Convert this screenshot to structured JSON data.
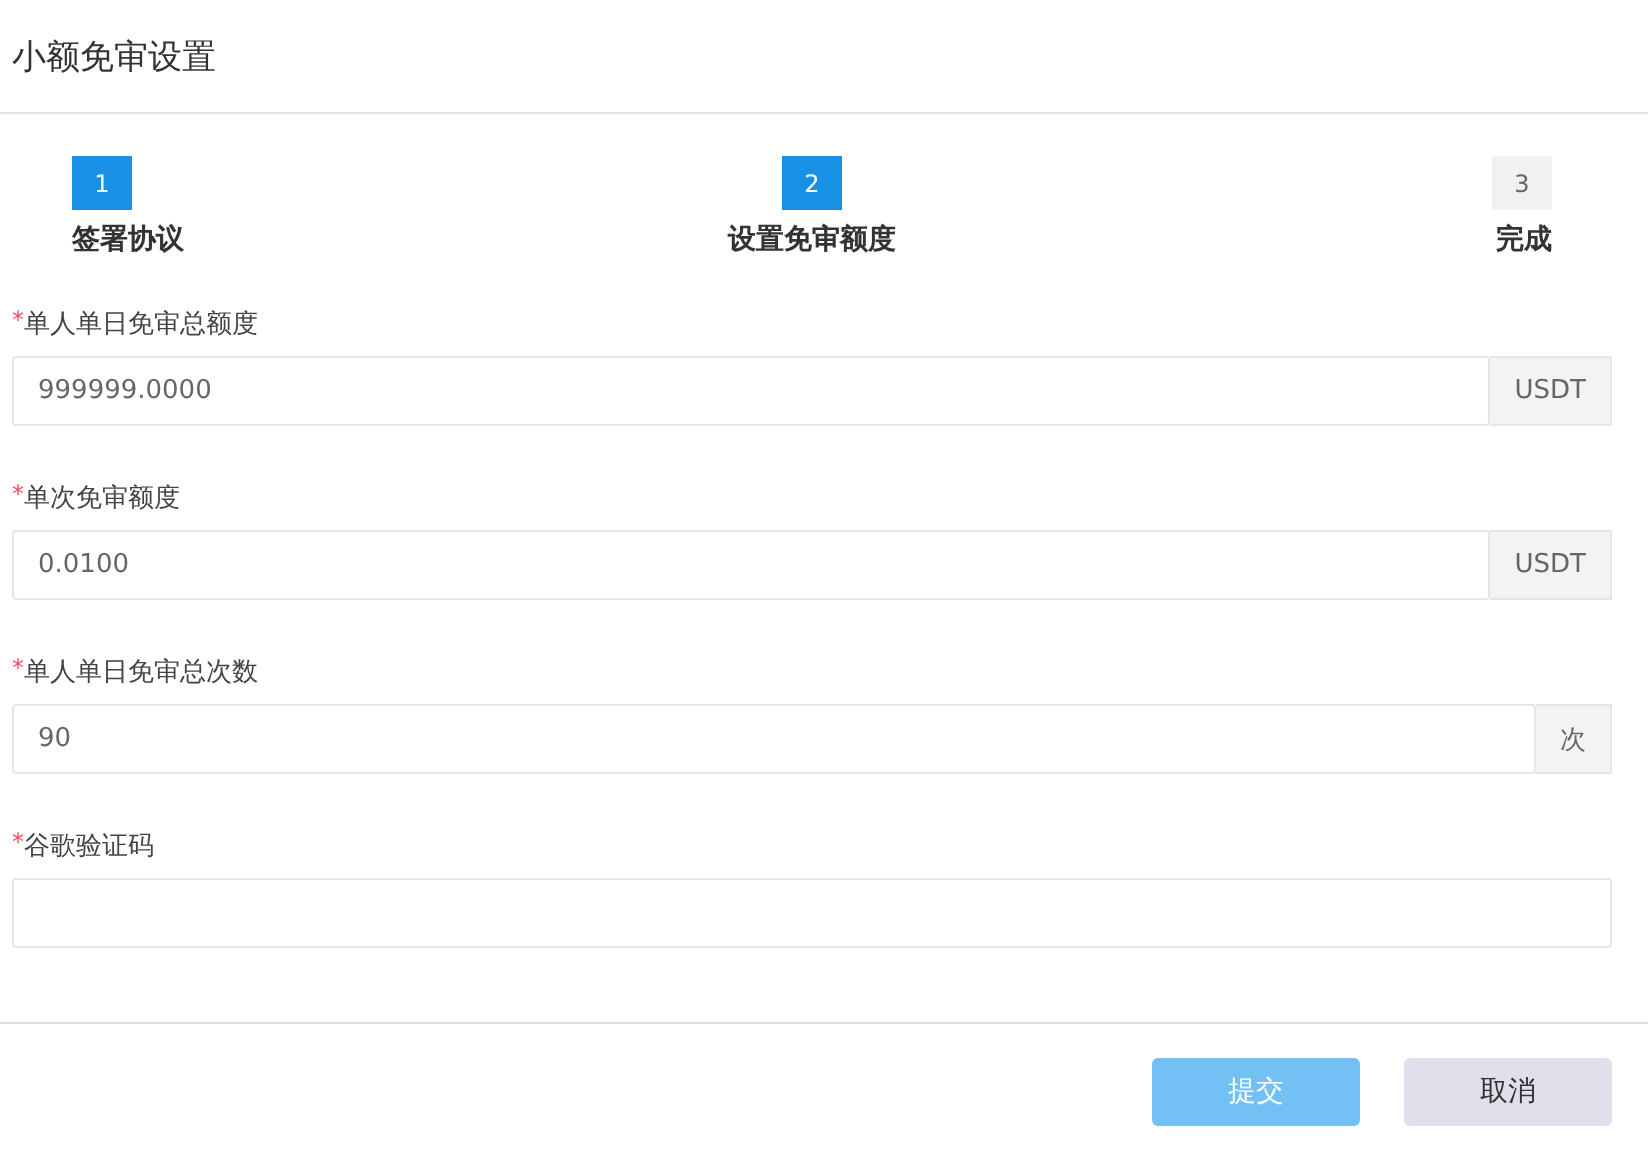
{
  "dialog": {
    "title": "小额免审设置"
  },
  "steps": [
    {
      "number": "1",
      "label": "签署协议",
      "active": true
    },
    {
      "number": "2",
      "label": "设置免审额度",
      "active": true
    },
    {
      "number": "3",
      "label": "完成",
      "active": false
    }
  ],
  "fields": [
    {
      "label": "单人单日免审总额度",
      "required_mark": "*",
      "value": "999999.0000",
      "suffix": "USDT"
    },
    {
      "label": "单次免审额度",
      "required_mark": "*",
      "value": "0.0100",
      "suffix": "USDT"
    },
    {
      "label": "单人单日免审总次数",
      "required_mark": "*",
      "value": "90",
      "suffix": "次"
    },
    {
      "label": "谷歌验证码",
      "required_mark": "*"
    }
  ],
  "buttons": [
    {
      "label": "提交",
      "kind": "primary",
      "disabled": true
    },
    {
      "label": "取消",
      "kind": "secondary",
      "disabled": false
    }
  ]
}
